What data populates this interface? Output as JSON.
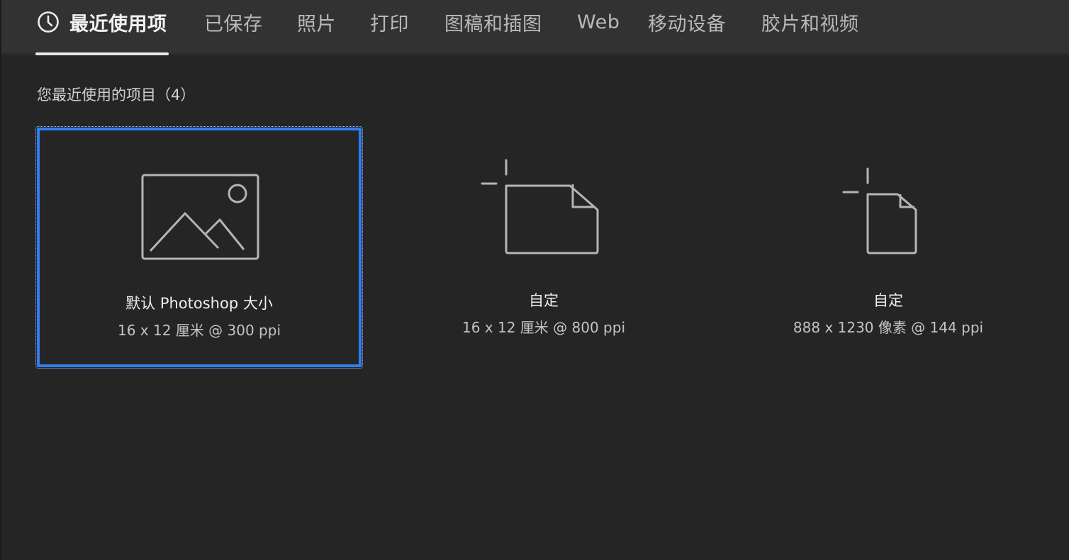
{
  "tabs": [
    {
      "label": "最近使用项",
      "icon": "clock-icon",
      "active": true
    },
    {
      "label": "已保存"
    },
    {
      "label": "照片"
    },
    {
      "label": "打印"
    },
    {
      "label": "图稿和插图"
    },
    {
      "label": "Web"
    },
    {
      "label": "移动设备"
    },
    {
      "label": "胶片和视频"
    }
  ],
  "recent": {
    "heading": "您最近使用的项目（4）",
    "presets": [
      {
        "name": "默认 Photoshop 大小",
        "desc": "16 x 12 厘米 @ 300 ppi",
        "icon": "image-placeholder-icon",
        "selected": true
      },
      {
        "name": "自定",
        "desc": "16 x 12 厘米 @ 800 ppi",
        "icon": "landscape-document-icon"
      },
      {
        "name": "自定",
        "desc": "888 x 1230 像素 @ 144 ppi",
        "icon": "portrait-document-icon"
      }
    ]
  },
  "colors": {
    "background": "#252525",
    "tabbar": "#323232",
    "selection": "#2f7ff0",
    "icon_stroke": "#b5b5b5"
  }
}
